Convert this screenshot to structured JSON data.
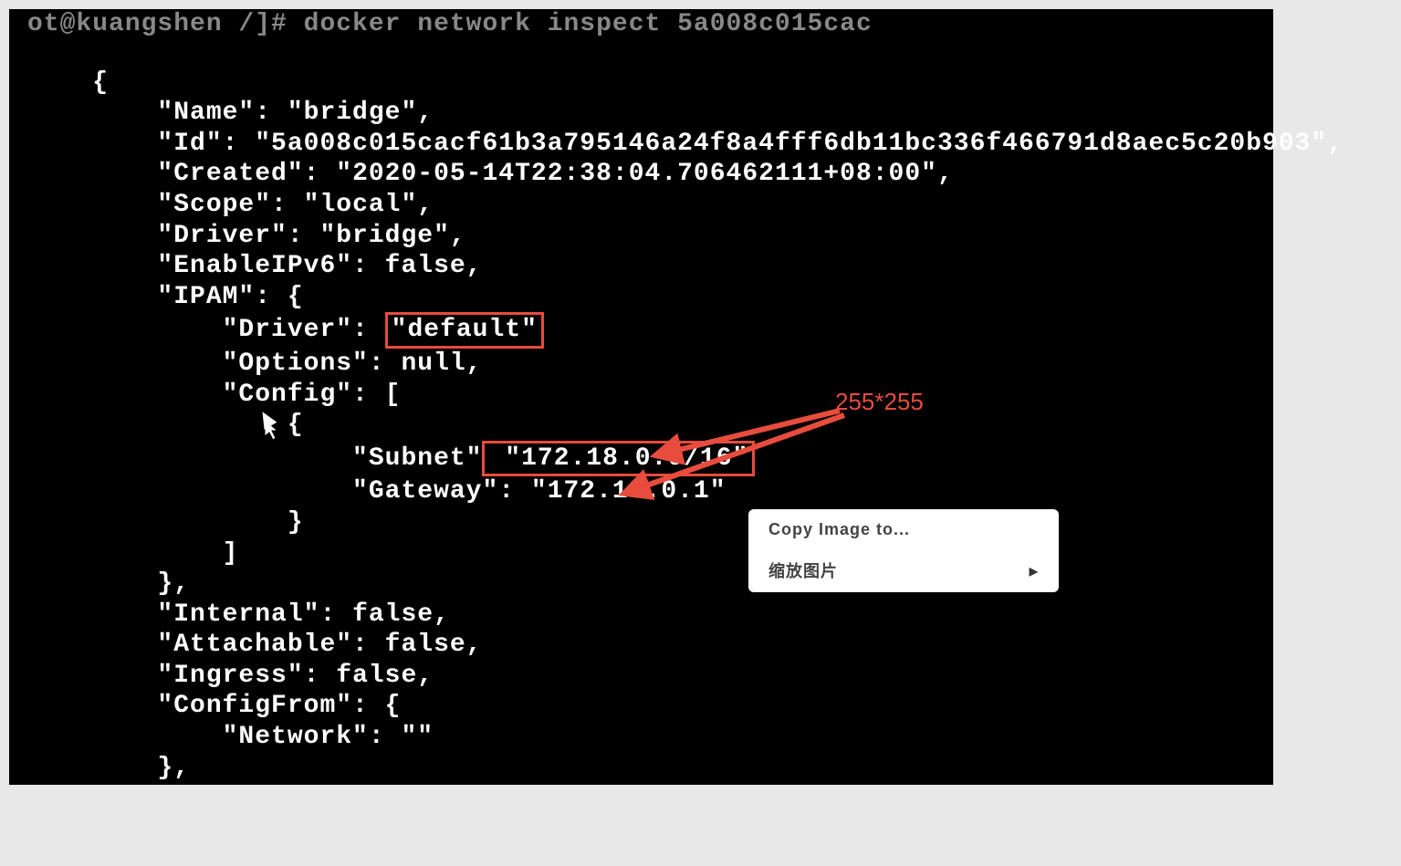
{
  "terminal": {
    "prompt": "ot@kuangshen /]# docker network inspect 5a008c015cac",
    "lines": {
      "opening_brace": "    {",
      "name_key": "        \"Name\": ",
      "name_val": "\"bridge\",",
      "id_key": "        \"Id\": ",
      "id_val": "\"5a008c015cacf61b3a795146a24f8a4fff6db11bc336f466791d8aec5c20b903\",",
      "created_key": "        \"Created\": ",
      "created_val": "\"2020-05-14T22:38:04.706462111+08:00\",",
      "scope_key": "        \"Scope\": ",
      "scope_val": "\"local\",",
      "driver_key": "        \"Driver\": ",
      "driver_val": "\"bridge\",",
      "enableipv6_key": "        \"EnableIPv6\": ",
      "enableipv6_val": "false,",
      "ipam_key": "        \"IPAM\": {",
      "ipam_driver_key": "            \"Driver\": ",
      "ipam_driver_val": "\"default\"",
      "ipam_options_key": "            \"Options\": ",
      "ipam_options_val": "null,",
      "ipam_config_key": "            \"Config\": [",
      "config_open": "                {",
      "subnet_key": "                    \"Subnet\"",
      "subnet_val": " \"172.18.0.0/16\"",
      "gateway_key": "                    \"Gateway\": ",
      "gateway_val": "\"172.18.0.1\"",
      "config_close": "                }",
      "config_array_close": "            ]",
      "ipam_close": "        },",
      "internal_key": "        \"Internal\": ",
      "internal_val": "false,",
      "attachable_key": "        \"Attachable\": ",
      "attachable_val": "false,",
      "ingress_key": "        \"Ingress\": ",
      "ingress_val": "false,",
      "configfrom_key": "        \"ConfigFrom\": {",
      "network_key": "            \"Network\": ",
      "network_val": "\"\"",
      "configfrom_close": "        },"
    }
  },
  "annotation": {
    "label": "255*255"
  },
  "context_menu": {
    "item1": "Copy Image to...",
    "item2": "缩放图片"
  },
  "colors": {
    "highlight_red": "#e74c3c",
    "terminal_bg": "#000000",
    "terminal_fg": "#ffffff"
  }
}
